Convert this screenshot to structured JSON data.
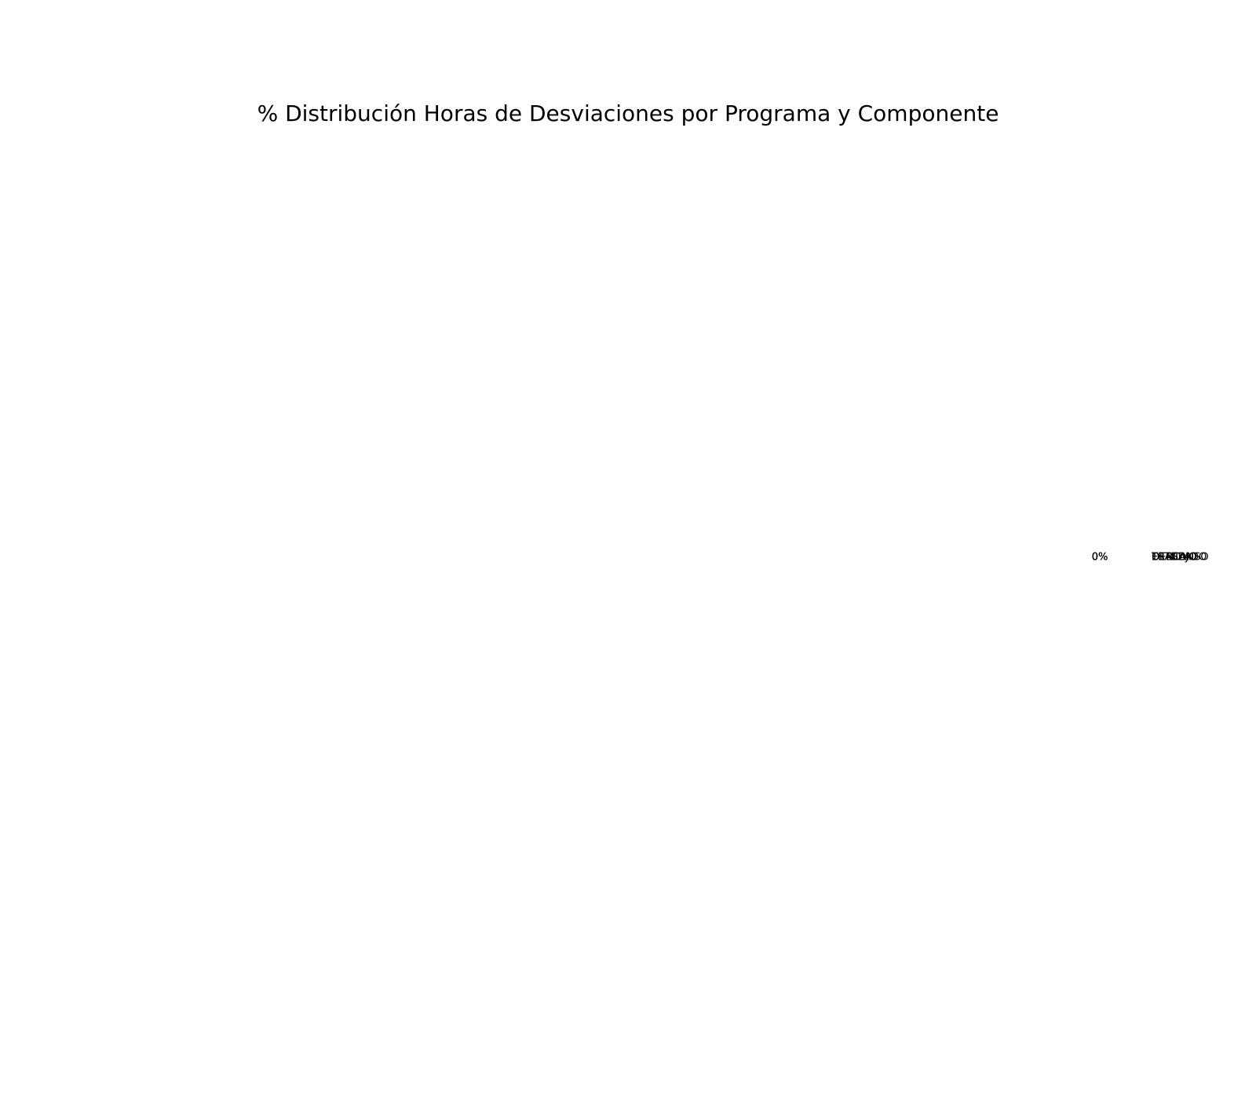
{
  "chart_data": {
    "type": "pie",
    "title": "% Distribución Horas de Desviaciones por Programa y Componente",
    "slices": [
      {
        "label": "TRABAJO",
        "value": 0,
        "pct_label": "0%"
      },
      {
        "label": "ESTUDIO",
        "value": 0,
        "pct_label": "0%"
      },
      {
        "label": "DESCANSO",
        "value": 0,
        "pct_label": "0%"
      },
      {
        "label": "TRASLADO",
        "value": 0,
        "pct_label": "0%"
      },
      {
        "label": "OTRO",
        "value": 0,
        "pct_label": "0%"
      }
    ],
    "legend": "none"
  }
}
